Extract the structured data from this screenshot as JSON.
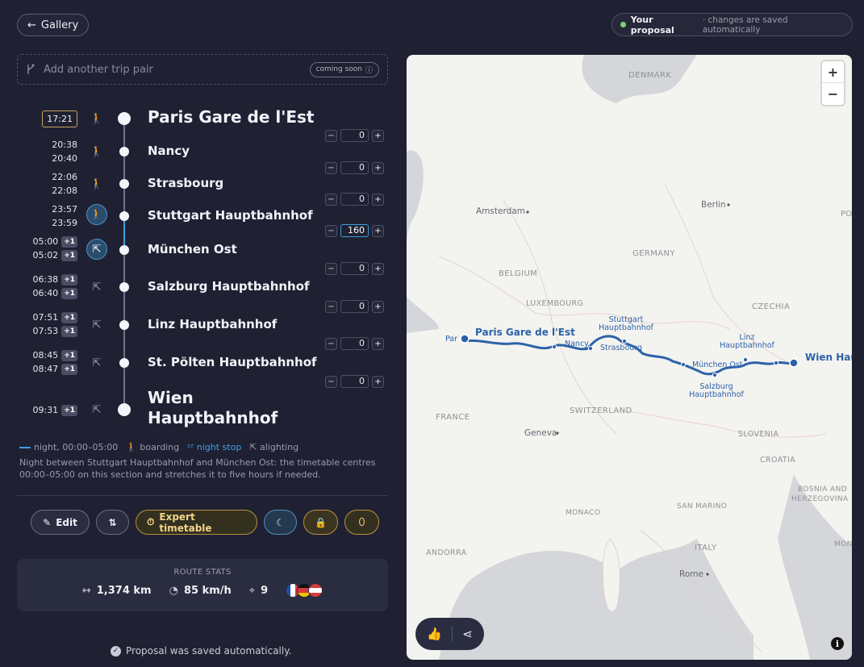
{
  "header": {
    "back_label": "Gallery",
    "proposal_title": "Your proposal",
    "proposal_sub": "· changes are saved automatically"
  },
  "trip_pair": {
    "placeholder": "Add another trip pair",
    "badge": "coming soon"
  },
  "stops": [
    {
      "name": "Paris Gare de l'Est",
      "times": [
        "17:21"
      ],
      "plus": [
        false
      ],
      "mode": "boarding"
    },
    {
      "name": "Nancy",
      "times": [
        "20:38",
        "20:40"
      ],
      "plus": [
        false,
        false
      ],
      "mode": "boarding"
    },
    {
      "name": "Strasbourg",
      "times": [
        "22:06",
        "22:08"
      ],
      "plus": [
        false,
        false
      ],
      "mode": "boarding"
    },
    {
      "name": "Stuttgart Hauptbahnhof",
      "times": [
        "23:57",
        "23:59"
      ],
      "plus": [
        false,
        false
      ],
      "mode": "boarding"
    },
    {
      "name": "München Ost",
      "times": [
        "05:00",
        "05:02"
      ],
      "plus": [
        true,
        true
      ],
      "mode": "alighting"
    },
    {
      "name": "Salzburg Hauptbahnhof",
      "times": [
        "06:38",
        "06:40"
      ],
      "plus": [
        true,
        true
      ],
      "mode": "alighting"
    },
    {
      "name": "Linz Hauptbahnhof",
      "times": [
        "07:51",
        "07:53"
      ],
      "plus": [
        true,
        true
      ],
      "mode": "alighting"
    },
    {
      "name": "St. Pölten Hauptbahnhof",
      "times": [
        "08:45",
        "08:47"
      ],
      "plus": [
        true,
        true
      ],
      "mode": "alighting"
    },
    {
      "name": "Wien Hauptbahnhof",
      "times": [
        "09:31"
      ],
      "plus": [
        true
      ],
      "mode": "alighting"
    }
  ],
  "plus_label": "+1",
  "steppers": [
    "0",
    "0",
    "0",
    "160",
    "0",
    "0",
    "0",
    "0"
  ],
  "legend": {
    "night": "night, 00:00–05:00",
    "boarding": "boarding",
    "night_stop": "night stop",
    "alighting": "alighting",
    "note": "Night between Stuttgart Hauptbahnhof and München Ost: the timetable centres 00:00–05:00 on this section and stretches it to five hours if needed."
  },
  "actions": {
    "edit": "Edit",
    "expert": "Expert timetable"
  },
  "stats": {
    "header": "ROUTE STATS",
    "distance": "1,374 km",
    "speed": "85 km/h",
    "stops": "9"
  },
  "saved_msg": "Proposal was saved automatically.",
  "map": {
    "countries": [
      "DENMARK",
      "GERMANY",
      "BELGIUM",
      "LUXEMBOURG",
      "CZECHIA",
      "FRANCE",
      "SWITZERLAND",
      "SLOVENIA",
      "CROATIA",
      "BOSNIA AND",
      "HERZEGOVINA",
      "MONACO",
      "SAN MARINO",
      "ANDORRA",
      "ITALY",
      "MONT",
      "PO"
    ],
    "cities": [
      "Amsterdam",
      "Berlin",
      "Geneva",
      "Rome"
    ],
    "route_labels": {
      "paris": "Paris Gare de l'Est",
      "paris_clip": "Par",
      "stuttgart": "Stuttgart Hauptbahnhof",
      "nancy": "Nancy",
      "strasbourg": "Strasbourg",
      "muenchen": "München Ost",
      "salzburg": "Salzburg Hauptbahnhof",
      "linz": "Linz Hauptbahnhof",
      "wien": "Wien Hauptbahnhof"
    },
    "zoom_in": "+",
    "zoom_out": "−"
  },
  "colors": {
    "background": "#1f2133",
    "accent_blue": "#3ea0e0",
    "accent_gold": "#c7a35a",
    "route": "#2d62a8"
  }
}
